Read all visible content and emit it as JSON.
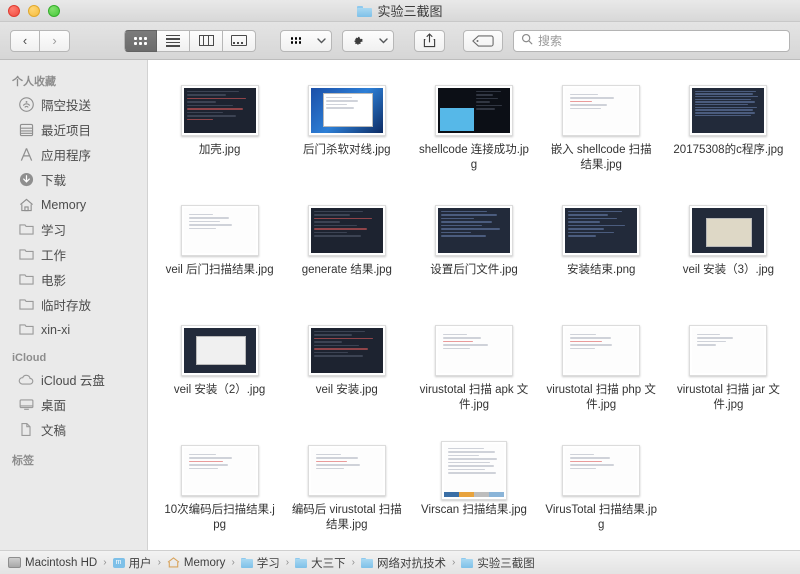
{
  "window": {
    "title": "实验三截图",
    "title_icon": "folder-icon",
    "traffic_lights": [
      "close-button",
      "minimize-button",
      "maximize-button"
    ]
  },
  "toolbar": {
    "back_label": "‹",
    "forward_label": "›",
    "views": [
      {
        "name": "icon-view",
        "icon": "grid-icon",
        "active": true
      },
      {
        "name": "list-view",
        "icon": "list-icon",
        "active": false
      },
      {
        "name": "column-view",
        "icon": "columns-icon",
        "active": false
      },
      {
        "name": "gallery-view",
        "icon": "gallery-icon",
        "active": false
      }
    ],
    "arrange_icon": "arrange-grid-icon",
    "action_icon": "gear-icon",
    "share_icon": "share-icon",
    "tag_icon": "tag-icon",
    "chevron": "⌄"
  },
  "search": {
    "icon": "search-icon",
    "placeholder": "搜索",
    "value": ""
  },
  "sidebar": {
    "sections": [
      {
        "header": "个人收藏",
        "items": [
          {
            "label": "隔空投送",
            "icon": "airdrop-icon"
          },
          {
            "label": "最近项目",
            "icon": "recents-icon"
          },
          {
            "label": "应用程序",
            "icon": "applications-icon"
          },
          {
            "label": "下载",
            "icon": "downloads-icon"
          },
          {
            "label": "Memory",
            "icon": "home-icon"
          },
          {
            "label": "学习",
            "icon": "folder-icon"
          },
          {
            "label": "工作",
            "icon": "folder-icon"
          },
          {
            "label": "电影",
            "icon": "folder-icon"
          },
          {
            "label": "临时存放",
            "icon": "folder-icon"
          },
          {
            "label": "xin-xi",
            "icon": "folder-icon"
          }
        ]
      },
      {
        "header": "iCloud",
        "items": [
          {
            "label": "iCloud 云盘",
            "icon": "cloud-icon"
          },
          {
            "label": "桌面",
            "icon": "desktop-icon"
          },
          {
            "label": "文稿",
            "icon": "documents-icon"
          }
        ]
      },
      {
        "header": "标签",
        "items": []
      }
    ]
  },
  "files": [
    {
      "name": "加壳.jpg",
      "thumb": "dark-code"
    },
    {
      "name": "后门杀软对线.jpg",
      "thumb": "blue-desktop"
    },
    {
      "name": "shellcode 连接成功.jpg",
      "thumb": "dark-terminal"
    },
    {
      "name": "嵌入 shellcode 扫描结果.jpg",
      "thumb": "white-report"
    },
    {
      "name": "20175308的c程序.jpg",
      "thumb": "dark-dense"
    },
    {
      "name": "veil 后门扫描结果.jpg",
      "thumb": "white-report"
    },
    {
      "name": "generate 结果.jpg",
      "thumb": "dark-code"
    },
    {
      "name": "设置后门文件.jpg",
      "thumb": "dark-code"
    },
    {
      "name": "安装结束.png",
      "thumb": "dark-code"
    },
    {
      "name": "veil 安装（3）.jpg",
      "thumb": "dark-dialog"
    },
    {
      "name": "veil 安装（2）.jpg",
      "thumb": "dark-dialog"
    },
    {
      "name": "veil 安装.jpg",
      "thumb": "dark-code"
    },
    {
      "name": "virustotal 扫描 apk 文件.jpg",
      "thumb": "white-report"
    },
    {
      "name": "virustotal 扫描 php 文件.jpg",
      "thumb": "white-report"
    },
    {
      "name": "virustotal 扫描 jar 文件.jpg",
      "thumb": "white-report"
    },
    {
      "name": "10次编码后扫描结果.jpg",
      "thumb": "white-report"
    },
    {
      "name": "编码后 virustotal 扫描结果.jpg",
      "thumb": "white-report"
    },
    {
      "name": "Virscan 扫描结果.jpg",
      "thumb": "white-table"
    },
    {
      "name": "VirusTotal 扫描结果.jpg",
      "thumb": "white-report"
    }
  ],
  "pathbar": {
    "separator": "›",
    "crumbs": [
      {
        "label": "Macintosh HD",
        "icon": "disk-icon"
      },
      {
        "label": "用户",
        "icon": "users-icon"
      },
      {
        "label": "Memory",
        "icon": "home-icon"
      },
      {
        "label": "学习",
        "icon": "folder-icon"
      },
      {
        "label": "大三下",
        "icon": "folder-icon"
      },
      {
        "label": "网络对抗技术",
        "icon": "folder-icon"
      },
      {
        "label": "实验三截图",
        "icon": "folder-icon"
      }
    ]
  },
  "colors": {
    "accent_folder": "#7ec0e8",
    "toolbar_bg": "#dcdcdc",
    "sidebar_bg": "#eaeaea",
    "active_view": "#6c6c6c"
  }
}
